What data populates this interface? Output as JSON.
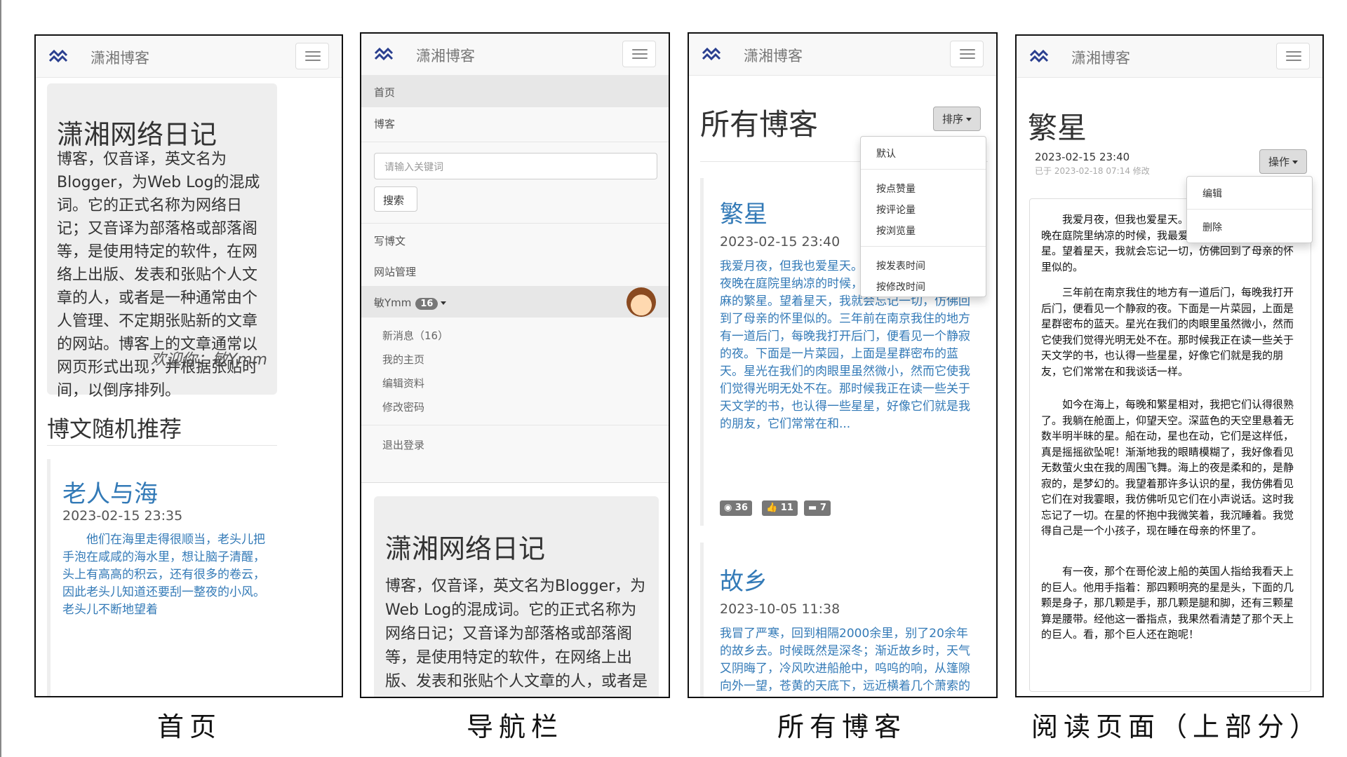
{
  "brand": "潇湘博客",
  "captions": [
    "首页",
    "导航栏",
    "所有博客",
    "阅读页面（上部分）"
  ],
  "home": {
    "jumbotron_title": "潇湘网络日记",
    "jumbotron_text": "博客，仅音译，英文名为Blogger，为Web Log的混成词。它的正式名称为网络日记；又音译为部落格或部落阁等，是使用特定的软件，在网络上出版、发表和张贴个人文章的人，或者是一种通常由个人管理、不定期张贴新的文章的网站。博客上的文章通常以网页形式出现，并根据张贴时间，以倒序排列。",
    "welcome": "欢迎你：敏Ymm",
    "section_title": "博文随机推荐",
    "post_title": "老人与海",
    "post_date": "2023-02-15 23:35",
    "post_excerpt": "他们在海里走得很顺当，老头儿把手泡在咸咸的海水里，想让脑子清醒，头上有高高的积云，还有很多的卷云，因此老头儿知道还要刮一整夜的小风。老头儿不断地望着"
  },
  "nav": {
    "items": [
      "首页",
      "博客"
    ],
    "search_placeholder": "请输入关键词",
    "search_button": "搜索",
    "items2": [
      "写博文",
      "网站管理"
    ],
    "user": "敏Ymm",
    "user_badge": "16",
    "sub_items": [
      "新消息（16）",
      "我的主页",
      "编辑资料",
      "修改密码"
    ],
    "logout": "退出登录",
    "jumbotron_title": "潇湘网络日记",
    "jumbotron_text": "博客，仅音译，英文名为Blogger，为Web Log的混成词。它的正式名称为网络日记；又音译为部落格或部落阁等，是使用特定的软件，在网络上出版、发表和张贴个人文章的人，或者是一种通常由个人管"
  },
  "blogs": {
    "title": "所有博客",
    "sort_button": "排序",
    "sort_options": [
      "默认",
      "按点赞量",
      "按评论量",
      "按浏览量",
      "按发表时间",
      "按修改时间"
    ],
    "posts": [
      {
        "title": "繁星",
        "date": "2023-02-15 23:40",
        "excerpt": "我爱月夜，但我也爱星天。从前在家乡七八月的夜晚在庭院里纳凉的时候，我最爱看天上密密麻麻的繁星。望着星天，我就会忘记一切，仿佛回到了母亲的怀里似的。三年前在南京我住的地方有一道后门，每晚我打开后门，便看见一个静寂的夜。下面是一片菜园，上面是星群密布的蓝天。星光在我们的肉眼里虽然微小，然而它使我们觉得光明无处不在。那时候我正在读一些关于天文学的书，也认得一些星星，好像它们就是我的朋友，它们常常在和...",
        "views": "36",
        "likes": "11",
        "comments": "7"
      },
      {
        "title": "故乡",
        "date": "2023-10-05 11:38",
        "excerpt": "我冒了严寒，回到相隔2000余里，别了20余年的故乡去。时候既然是深冬；渐近故乡时，天气又阴晦了，冷风吹进船舱中，呜呜的响，从篷隙向外一望，苍黄的天底下，远近横着几个萧索的荒村，没有一些活气。我的心禁不住悲凉起来了。阿！这不是我20年"
      }
    ]
  },
  "read": {
    "title": "繁星",
    "date": "2023-02-15 23:40",
    "modified": "已于 2023-02-18 07:14 修改",
    "action_button": "操作",
    "action_options": [
      "编辑",
      "删除"
    ],
    "paragraphs": [
      "我爱月夜，但我也爱星天。从前在家乡七八月的夜晚在庭院里纳凉的时候，我最爱看天上密密麻麻的繁星。望着星天，我就会忘记一切，仿佛回到了母亲的怀里似的。",
      "三年前在南京我住的地方有一道后门，每晚我打开后门，便看见一个静寂的夜。下面是一片菜园，上面是星群密布的蓝天。星光在我们的肉眼里虽然微小，然而它使我们觉得光明无处不在。那时候我正在读一些关于天文学的书，也认得一些星星，好像它们就是我的朋友，它们常常在和我谈话一样。",
      "如今在海上，每晚和繁星相对，我把它们认得很熟了。我躺在舱面上，仰望天空。深蓝色的天空里悬着无数半明半昧的星。船在动，星也在动，它们是这样低，真是摇摇欲坠呢！渐渐地我的眼睛模糊了，我好像看见无数萤火虫在我的周围飞舞。海上的夜是柔和的，是静寂的，是梦幻的。我望着那许多认识的星，我仿佛看见它们在对我霎眼，我仿佛听见它们在小声说话。这时我忘记了一切。在星的怀抱中我微笑着，我沉睡着。我觉得自己是一个小孩子，现在睡在母亲的怀里了。",
      "有一夜，那个在哥伦波上船的英国人指给我看天上的巨人。他用手指着：那四颗明亮的星是头，下面的几颗是身子，那几颗是手，那几颗是腿和脚，还有三颗星算是腰带。经他这一番指点，我果然看清楚了那个天上的巨人。看，那个巨人还在跑呢！"
    ]
  },
  "colors": {
    "link": "#337ab7",
    "navbar": "#f8f8f8",
    "jumbotron": "#eeeeee",
    "badge": "#777777"
  }
}
